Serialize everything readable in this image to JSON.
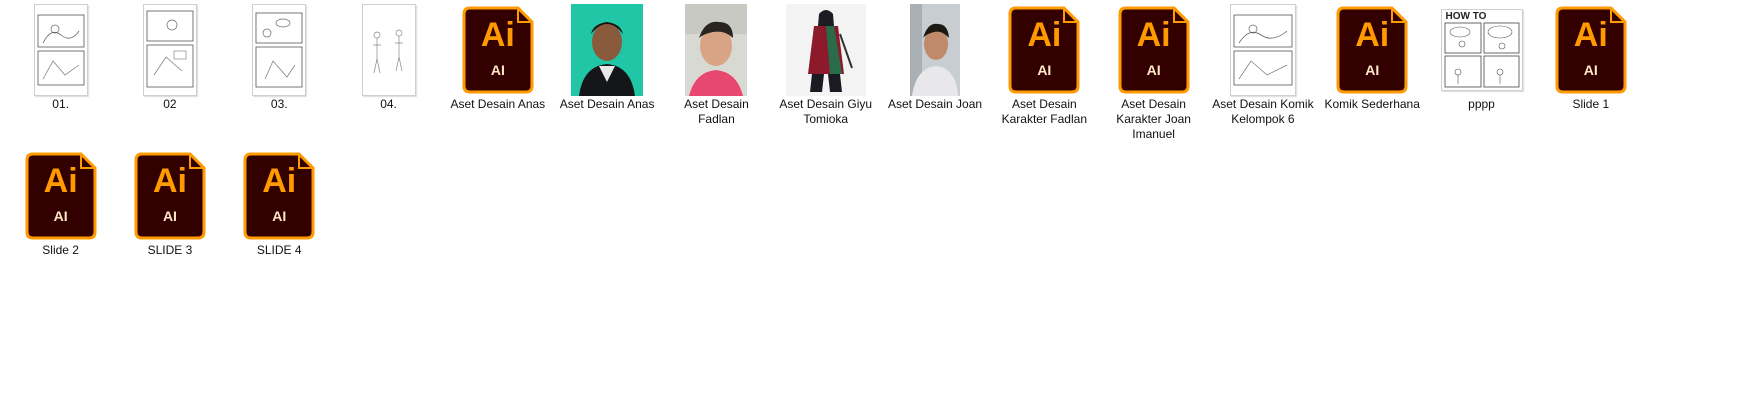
{
  "files": [
    {
      "name": "01.",
      "kind": "sketch"
    },
    {
      "name": "02",
      "kind": "sketch"
    },
    {
      "name": "03.",
      "kind": "sketch"
    },
    {
      "name": "04.",
      "kind": "sketch"
    },
    {
      "name": "Aset Desain Anas",
      "kind": "ai"
    },
    {
      "name": "Aset Desain Anas",
      "kind": "photo"
    },
    {
      "name": "Aset Desain Fadlan",
      "kind": "photo"
    },
    {
      "name": "Aset Desain Giyu Tomioka",
      "kind": "photo"
    },
    {
      "name": "Aset Desain Joan",
      "kind": "photo"
    },
    {
      "name": "Aset Desain Karakter Fadlan",
      "kind": "ai"
    },
    {
      "name": "Aset Desain Karakter Joan Imanuel",
      "kind": "ai"
    },
    {
      "name": "Aset Desain Komik Kelompok 6",
      "kind": "sketch"
    },
    {
      "name": "Komik Sederhana",
      "kind": "ai"
    },
    {
      "name": "pppp",
      "kind": "comic"
    },
    {
      "name": "Slide 1",
      "kind": "ai"
    },
    {
      "name": "Slide 2",
      "kind": "ai"
    },
    {
      "name": "SLIDE 3",
      "kind": "ai"
    },
    {
      "name": "SLIDE 4",
      "kind": "ai"
    }
  ],
  "ai_icon": {
    "big": "Ai",
    "small": "AI",
    "bg": "#330000",
    "accent": "#FF9A00"
  },
  "comic_header": "HOW TO"
}
